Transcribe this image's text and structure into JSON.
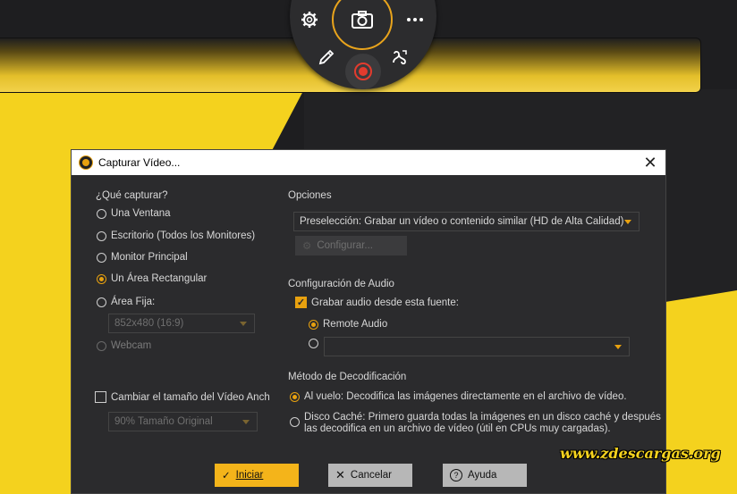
{
  "window": {
    "title": "Capturar Vídeo..."
  },
  "capture": {
    "heading": "¿Qué capturar?",
    "options": [
      "Una Ventana",
      "Escritorio (Todos los Monitores)",
      "Monitor Principal",
      "Un Área Rectangular",
      "Área Fija:",
      "Webcam"
    ],
    "selected": "Un Área Rectangular",
    "fixed_size": "852x480 (16:9)"
  },
  "resize": {
    "label": "Cambiar el tamaño del Vídeo Anch",
    "value": "90% Tamaño Original"
  },
  "options_section": {
    "heading": "Opciones",
    "preset": "Preselección: Grabar un vídeo o contenido similar (HD de Alta Calidad)",
    "configure_label": "Configurar..."
  },
  "audio": {
    "heading": "Configuración de Audio",
    "record_label": "Grabar audio desde esta fuente:",
    "source_selected": "Remote Audio",
    "other_source": ""
  },
  "decode": {
    "heading": "Método de Decodificación",
    "option1": "Al vuelo: Decodifica las imágenes directamente en el archivo de vídeo.",
    "option2_line1": "Disco Caché: Primero guarda todas la imágenes en un disco caché y después",
    "option2_line2": "las decodifica en un archivo de vídeo (útil en CPUs muy cargadas)."
  },
  "buttons": {
    "start": "Iniciar",
    "cancel": "Cancelar",
    "help": "Ayuda"
  },
  "watermark": "www.zdescargas.org",
  "colors": {
    "accent": "#e8a10f",
    "record": "#e33b2e",
    "background_yellow": "#f4d21e"
  }
}
